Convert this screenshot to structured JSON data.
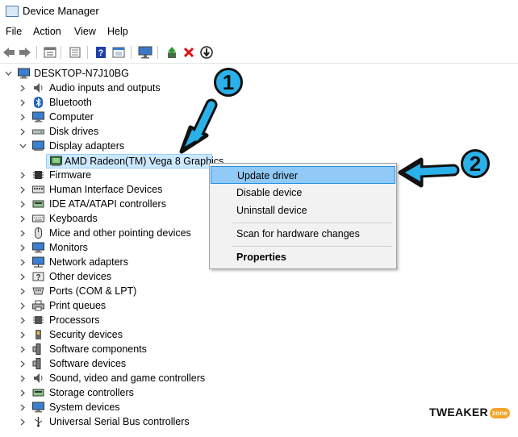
{
  "window": {
    "title": "Device Manager"
  },
  "menu": [
    "File",
    "Action",
    "View",
    "Help"
  ],
  "toolbar": {
    "icons": [
      "back-arrow-icon",
      "forward-arrow-icon",
      "properties-sheet-icon",
      "show-hidden-icon",
      "help-icon",
      "update-view-icon",
      "scan-monitor-icon",
      "enable-device-icon",
      "uninstall-x-icon",
      "update-driver-down-icon"
    ]
  },
  "tree": {
    "root": "DESKTOP-N7J10BG",
    "categories": [
      {
        "label": "Audio inputs and outputs",
        "icon": "speaker-icon",
        "expanded": false
      },
      {
        "label": "Bluetooth",
        "icon": "bluetooth-icon",
        "expanded": false
      },
      {
        "label": "Computer",
        "icon": "computer-icon",
        "expanded": false
      },
      {
        "label": "Disk drives",
        "icon": "disk-drive-icon",
        "expanded": false
      },
      {
        "label": "Display adapters",
        "icon": "display-adapter-icon",
        "expanded": true,
        "children": [
          "AMD Radeon(TM) Vega 8 Graphics"
        ]
      },
      {
        "label": "Firmware",
        "icon": "firmware-icon",
        "expanded": false
      },
      {
        "label": "Human Interface Devices",
        "icon": "hid-icon",
        "expanded": false
      },
      {
        "label": "IDE ATA/ATAPI controllers",
        "icon": "ide-controller-icon",
        "expanded": false
      },
      {
        "label": "Keyboards",
        "icon": "keyboard-icon",
        "expanded": false
      },
      {
        "label": "Mice and other pointing devices",
        "icon": "mouse-icon",
        "expanded": false
      },
      {
        "label": "Monitors",
        "icon": "monitor-icon",
        "expanded": false
      },
      {
        "label": "Network adapters",
        "icon": "network-adapter-icon",
        "expanded": false
      },
      {
        "label": "Other devices",
        "icon": "other-devices-icon",
        "expanded": false
      },
      {
        "label": "Ports (COM & LPT)",
        "icon": "port-icon",
        "expanded": false
      },
      {
        "label": "Print queues",
        "icon": "printer-icon",
        "expanded": false
      },
      {
        "label": "Processors",
        "icon": "processor-icon",
        "expanded": false
      },
      {
        "label": "Security devices",
        "icon": "security-device-icon",
        "expanded": false
      },
      {
        "label": "Software components",
        "icon": "software-component-icon",
        "expanded": false
      },
      {
        "label": "Software devices",
        "icon": "software-device-icon",
        "expanded": false
      },
      {
        "label": "Sound, video and game controllers",
        "icon": "sound-controller-icon",
        "expanded": false
      },
      {
        "label": "Storage controllers",
        "icon": "storage-controller-icon",
        "expanded": false
      },
      {
        "label": "System devices",
        "icon": "system-device-icon",
        "expanded": false
      },
      {
        "label": "Universal Serial Bus controllers",
        "icon": "usb-icon",
        "expanded": false
      }
    ]
  },
  "context_menu": {
    "items": [
      {
        "label": "Update driver",
        "highlighted": true
      },
      {
        "label": "Disable device"
      },
      {
        "label": "Uninstall device"
      },
      {
        "label": "Scan for hardware changes"
      },
      {
        "label": "Properties",
        "bold": true
      }
    ]
  },
  "annotations": {
    "step1": "1",
    "step2": "2",
    "color": "#2ab1ea"
  },
  "watermark": {
    "brand": "TWEAKER",
    "sub": "zone"
  }
}
